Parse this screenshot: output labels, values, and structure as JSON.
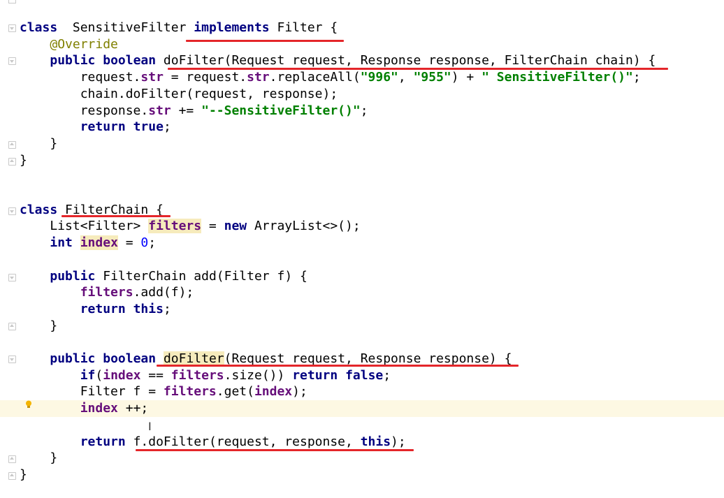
{
  "editor": {
    "lines": [
      {
        "parts": [
          [
            "kw",
            "class"
          ],
          [
            "",
            "  SensitiveFilter "
          ],
          [
            "kw",
            "implements"
          ],
          [
            "",
            " Filter {"
          ]
        ]
      },
      {
        "parts": [
          [
            "",
            "    "
          ],
          [
            "ann",
            "@Override"
          ]
        ]
      },
      {
        "parts": [
          [
            "",
            "    "
          ],
          [
            "kw",
            "public"
          ],
          [
            "",
            " "
          ],
          [
            "kw",
            "boolean"
          ],
          [
            "",
            " doFilter(Request request, Response response, FilterChain chain) {"
          ]
        ]
      },
      {
        "parts": [
          [
            "",
            "        request."
          ],
          [
            "field",
            "str"
          ],
          [
            "",
            " = request."
          ],
          [
            "field",
            "str"
          ],
          [
            ".replaceAll(",
            ""
          ],
          [
            "str",
            "\"996\""
          ],
          [
            "",
            ", "
          ],
          [
            "str",
            "\"955\""
          ],
          [
            "",
            ") + "
          ],
          [
            "str",
            "\" SensitiveFilter()\""
          ],
          [
            "",
            ";"
          ]
        ]
      },
      {
        "parts": [
          [
            "",
            "        chain.doFilter(request, response);"
          ]
        ]
      },
      {
        "parts": [
          [
            "",
            "        response."
          ],
          [
            "field",
            "str"
          ],
          [
            "",
            " += "
          ],
          [
            "str",
            "\"--SensitiveFilter()\""
          ],
          [
            "",
            ";"
          ]
        ]
      },
      {
        "parts": [
          [
            "",
            "        "
          ],
          [
            "kw",
            "return"
          ],
          [
            "",
            " "
          ],
          [
            "kw",
            "true"
          ],
          [
            "",
            ";"
          ]
        ]
      },
      {
        "parts": [
          [
            "",
            "    }"
          ]
        ]
      },
      {
        "parts": [
          [
            "",
            "}"
          ]
        ]
      },
      {
        "parts": []
      },
      {
        "parts": []
      },
      {
        "parts": [
          [
            "kw",
            "class"
          ],
          [
            "",
            " FilterChain {"
          ]
        ]
      },
      {
        "parts": [
          [
            "",
            "    List<Filter> "
          ],
          [
            "field hl",
            "filters"
          ],
          [
            "",
            " = "
          ],
          [
            "kw",
            "new"
          ],
          [
            "",
            " ArrayList<>();"
          ]
        ]
      },
      {
        "parts": [
          [
            "",
            "    "
          ],
          [
            "kw",
            "int"
          ],
          [
            "",
            " "
          ],
          [
            "field hl",
            "index"
          ],
          [
            "",
            " = "
          ],
          [
            "num",
            "0"
          ],
          [
            "",
            ";"
          ]
        ]
      },
      {
        "parts": []
      },
      {
        "parts": [
          [
            "",
            "    "
          ],
          [
            "kw",
            "public"
          ],
          [
            "",
            " FilterChain add(Filter f) {"
          ]
        ]
      },
      {
        "parts": [
          [
            "",
            "        "
          ],
          [
            "field",
            "filters"
          ],
          [
            ".add(f);",
            ""
          ]
        ]
      },
      {
        "parts": [
          [
            "",
            "        "
          ],
          [
            "kw",
            "return"
          ],
          [
            "",
            " "
          ],
          [
            "kw",
            "this"
          ],
          [
            "",
            ";"
          ]
        ]
      },
      {
        "parts": [
          [
            "",
            "    }"
          ]
        ]
      },
      {
        "parts": []
      },
      {
        "parts": [
          [
            "",
            "    "
          ],
          [
            "kw",
            "public"
          ],
          [
            "",
            " "
          ],
          [
            "kw",
            "boolean"
          ],
          [
            "",
            " "
          ],
          [
            "hl",
            "doFilter"
          ],
          [
            "",
            "(Request request, Response response) {"
          ]
        ]
      },
      {
        "parts": [
          [
            "",
            "        "
          ],
          [
            "kw",
            "if"
          ],
          [
            "",
            "("
          ],
          [
            "field",
            "index"
          ],
          [
            "",
            " == "
          ],
          [
            "field",
            "filters"
          ],
          [
            ".size()) ",
            ""
          ],
          [
            "kw",
            "return"
          ],
          [
            "",
            " "
          ],
          [
            "kw",
            "false"
          ],
          [
            "",
            ";"
          ]
        ]
      },
      {
        "parts": [
          [
            "",
            "        Filter f = "
          ],
          [
            "field",
            "filters"
          ],
          [
            ".get(",
            ""
          ],
          [
            "field",
            "index"
          ],
          [
            "",
            ");"
          ]
        ]
      },
      {
        "parts": [
          [
            "",
            "        "
          ],
          [
            "field",
            "index"
          ],
          [
            "",
            " ++;"
          ]
        ]
      },
      {
        "parts": []
      },
      {
        "parts": [
          [
            "",
            "        "
          ],
          [
            "kw",
            "return"
          ],
          [
            "",
            " f.doFilter(request, response, "
          ],
          [
            "kw",
            "this"
          ],
          [
            "",
            ");"
          ]
        ]
      },
      {
        "parts": [
          [
            "",
            "    }"
          ]
        ]
      },
      {
        "parts": [
          [
            "",
            "}"
          ]
        ]
      }
    ],
    "current_line": 23,
    "caret_glyph": "I",
    "bulb_icon": "lightbulb-icon",
    "colors": {
      "keyword": "#000080",
      "field": "#660e7a",
      "string": "#008000",
      "number": "#0000ff",
      "annotation": "#808000",
      "highlight": "#f6ebbc",
      "current_line": "#fdf8e3",
      "underline": "#e4262a"
    }
  }
}
